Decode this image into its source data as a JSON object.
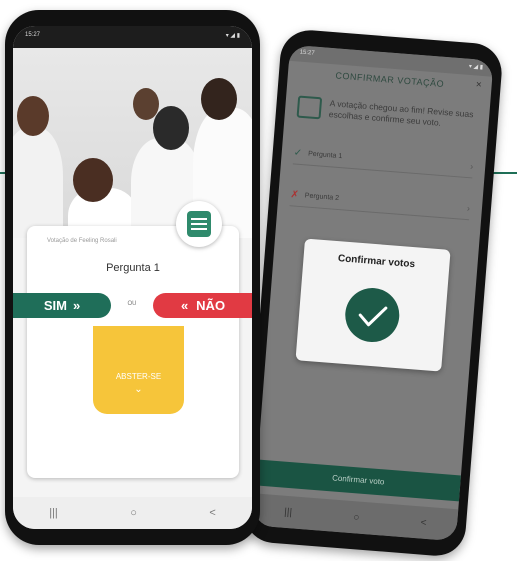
{
  "colors": {
    "brand_green": "#1f6e59",
    "no_red": "#e13a43",
    "abstain_yellow": "#f6c53a"
  },
  "front": {
    "status_time": "15:27",
    "card_title": "Votação de Feeling Rosali",
    "question": "Pergunta 1",
    "yes_label": "SIM",
    "yes_icon": "double-chevron-right",
    "or_label": "OU",
    "no_label": "NÃO",
    "no_icon": "double-chevron-left",
    "abstain_label": "ABSTER-SE",
    "abstain_icon": "chevron-down",
    "menu_icon": "list-icon",
    "nav": {
      "recent": "|||",
      "home": "○",
      "back": "<"
    }
  },
  "back": {
    "status_time": "15:27",
    "title": "CONFIRMAR VOTAÇÃO",
    "close": "×",
    "info_text": "A votação chegou ao fim! Revise suas escolhas e confirme seu voto.",
    "questions": [
      {
        "label": "Pergunta 1",
        "mark": "✓"
      },
      {
        "label": "Pergunta 2",
        "mark": "✗"
      }
    ],
    "dialog_title": "Confirmar votos",
    "confirm_button": "Confirmar voto",
    "nav": {
      "recent": "|||",
      "home": "○",
      "back": "<"
    }
  }
}
